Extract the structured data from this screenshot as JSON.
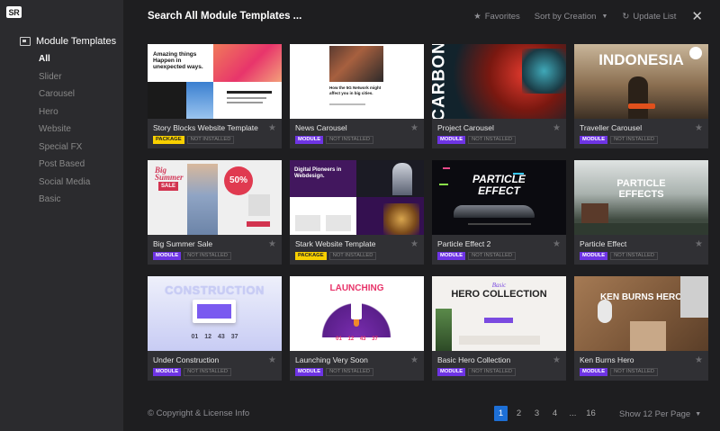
{
  "logo": "SR",
  "sidebar": {
    "heading": "Module Templates",
    "items": [
      "All",
      "Slider",
      "Carousel",
      "Hero",
      "Website",
      "Special FX",
      "Post Based",
      "Social Media",
      "Basic"
    ]
  },
  "header": {
    "title": "Search All Module Templates ...",
    "favorites": "Favorites",
    "sort": "Sort by Creation",
    "update": "Update List"
  },
  "cards": [
    {
      "name": "Story Blocks Website Template",
      "type": "PACKAGE",
      "status": "NOT INSTALLED",
      "thumb_text": "Amazing things Happen in unexpected ways."
    },
    {
      "name": "News Carousel",
      "type": "MODULE",
      "status": "NOT INSTALLED",
      "thumb_text": "How the 5G Network might affect you in big cities."
    },
    {
      "name": "Project Carousel",
      "type": "MODULE",
      "status": "NOT INSTALLED",
      "thumb_text": "CARBON"
    },
    {
      "name": "Traveller Carousel",
      "type": "MODULE",
      "status": "NOT INSTALLED",
      "thumb_text": "INDONESIA"
    },
    {
      "name": "Big Summer Sale",
      "type": "MODULE",
      "status": "NOT INSTALLED",
      "thumb_text": "50%"
    },
    {
      "name": "Stark Website Template",
      "type": "PACKAGE",
      "status": "NOT INSTALLED",
      "thumb_text": "Digital Pioneers in Webdesign."
    },
    {
      "name": "Particle Effect 2",
      "type": "MODULE",
      "status": "NOT INSTALLED",
      "thumb_text": "PARTICLE EFFECT"
    },
    {
      "name": "Particle Effect",
      "type": "MODULE",
      "status": "NOT INSTALLED",
      "thumb_text": "PARTICLE EFFECTS"
    },
    {
      "name": "Under Construction",
      "type": "MODULE",
      "status": "NOT INSTALLED",
      "thumb_text": "CONSTRUCTION"
    },
    {
      "name": "Launching Very Soon",
      "type": "MODULE",
      "status": "NOT INSTALLED",
      "thumb_text": "LAUNCHING"
    },
    {
      "name": "Basic Hero Collection",
      "type": "MODULE",
      "status": "NOT INSTALLED",
      "thumb_text": "HERO COLLECTION"
    },
    {
      "name": "Ken Burns Hero",
      "type": "MODULE",
      "status": "NOT INSTALLED",
      "thumb_text": "KEN BURNS HERO"
    }
  ],
  "footer": {
    "copyright": "© Copyright & License Info",
    "pages": [
      "1",
      "2",
      "3",
      "4",
      "...",
      "16"
    ],
    "current_page": "1",
    "per_page": "Show 12 Per Page"
  },
  "colors": {
    "accent": "#1d6fd6",
    "module_tag": "#6e34e4",
    "package_tag": "#f8d000"
  }
}
